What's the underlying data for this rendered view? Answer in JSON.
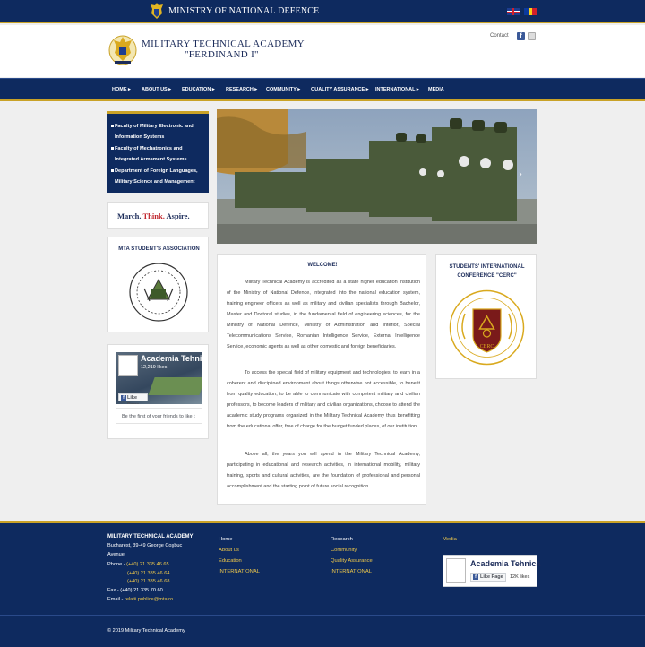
{
  "topbar": {
    "title": "MINISTRY OF NATIONAL DEFENCE",
    "flag_uk": "English",
    "flag_ro": "Romana"
  },
  "header": {
    "name_line1": "MILITARY TECHNICAL ACADEMY",
    "name_line2": "\"FERDINAND I\"",
    "contact": "Contact"
  },
  "nav": [
    "HOME ▸",
    "ABOUT US ▸",
    "EDUCATION ▸",
    "RESEARCH ▸",
    "COMMUNITY ▸",
    "QUALITY ASSURANCE ▸",
    "INTERNATIONAL ▸",
    "MEDIA"
  ],
  "faculties": [
    "Faculty of Military Electronic and Information Systems",
    "Faculty of Mechatronics and Integrated Armament Systems",
    "Department of Foreign Languages, Military Science and Management"
  ],
  "march": {
    "part1": "March.",
    "part2": "Think.",
    "part3": "Aspire."
  },
  "association": {
    "title": "MTA STUDENT'S ASSOCIATION"
  },
  "fb_widget": {
    "page_name": "Academia Tehni",
    "likes": "12,219 likes",
    "like_button": "Like Page",
    "friends_text": "Be the first of your friends to like t"
  },
  "welcome": {
    "title": "WELCOME!",
    "p1": "Military Technical Academy is accredited as a state higher education institution of the Ministry of National Defence, integrated into the national education system, training engineer officers as well as military and civilian specialists through Bachelor, Master and Doctoral studies, in the fundamental field of engineering sciences, for the Ministry of National Defence, Ministry of Administration and Interior, Special Telecommunications Service, Romanian Intelligence Service, External Intelligence Service, economic agents as well as other domestic and foreign beneficiaries.",
    "p2": "To access the special field of military equipment and technologies, to learn in a coherent and disciplined environment about things otherwise not accessible, to benefit from quality education, to be able to communicate with competent military and civilian professors, to become leaders of military and civilian organizations, choose to attend the academic study programs organized in the Military Technical Academy thus benefitting from the educational offer, free of charge for the budget funded places, of our institution.",
    "p3": "Above all, the years you will spend in the Military Technical Academy, participating in educational and research activities, in international mobility, military training, sports and cultural activities, are the foundation of professional and personal accomplishment and the starting point of future social recognition."
  },
  "conference": {
    "title": "STUDENTS' INTERNATIONAL CONFERENCE \"CERC\""
  },
  "footer": {
    "title": "MILITARY TECHNICAL ACADEMY",
    "address1": "Bucharest, 39-49 George Coşbuc",
    "address2": "Avenue",
    "phone_label": "Phone - ",
    "phone1": "(+40) 21 335 46 65",
    "phone2": "(+40) 21 335 46 64",
    "phone3": "(+40) 21 335 46 68",
    "fax": "Fax - (+40) 21 335 70 60",
    "email_label": "Email - ",
    "email": "relatii.publice@mta.ro",
    "col1": [
      "Home",
      "About us",
      "Education",
      "INTERNATIONAL"
    ],
    "col2": [
      "Research",
      "Community",
      "Quality Assurance",
      "INTERNATIONAL"
    ],
    "col3_title": "Media",
    "fb_name": "Academia Tehnică",
    "fb_like": "Like Page",
    "fb_likes": "12K likes",
    "copyright": "© 2019 Military Technical Academy"
  },
  "colors": {
    "navy": "#0e2a5f",
    "gold": "#c9a227",
    "link_yellow": "#f0c94a"
  }
}
